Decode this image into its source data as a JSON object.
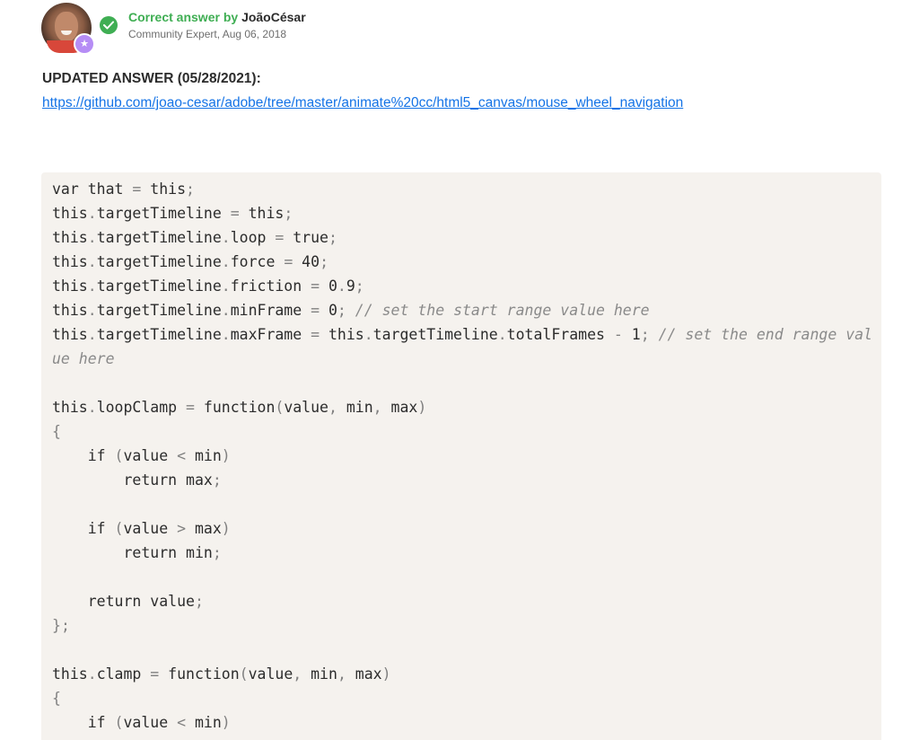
{
  "post": {
    "correct_label": "Correct answer by",
    "author_name": "JoãoCésar",
    "author_meta": "Community Expert, Aug 06, 2018",
    "badge_icon": "star-icon",
    "check_icon": "check-icon"
  },
  "content": {
    "updated_heading": "UPDATED ANSWER (05/28/2021):",
    "link_text": "https://github.com/joao-cesar/adobe/tree/master/animate%20cc/html5_canvas/mouse_wheel_navigation"
  },
  "code_block": {
    "lines": [
      "var that = this;",
      "this.targetTimeline = this;",
      "this.targetTimeline.loop = true;",
      "this.targetTimeline.force = 40;",
      "this.targetTimeline.friction = 0.9;",
      "this.targetTimeline.minFrame = 0; // set the start range value here",
      "this.targetTimeline.maxFrame = this.targetTimeline.totalFrames - 1; // set the end range val",
      "ue here",
      "",
      "this.loopClamp = function(value, min, max)",
      "{",
      "    if (value < min)",
      "        return max;",
      "",
      "    if (value > max)",
      "        return min;",
      "",
      "    return value;",
      "};",
      "",
      "this.clamp = function(value, min, max)",
      "{",
      "    if (value < min)"
    ]
  },
  "colors": {
    "correct_green": "#3fae53",
    "link_blue": "#1473e6",
    "expert_purple": "#b68df5",
    "code_bg": "#f5f2ee"
  }
}
